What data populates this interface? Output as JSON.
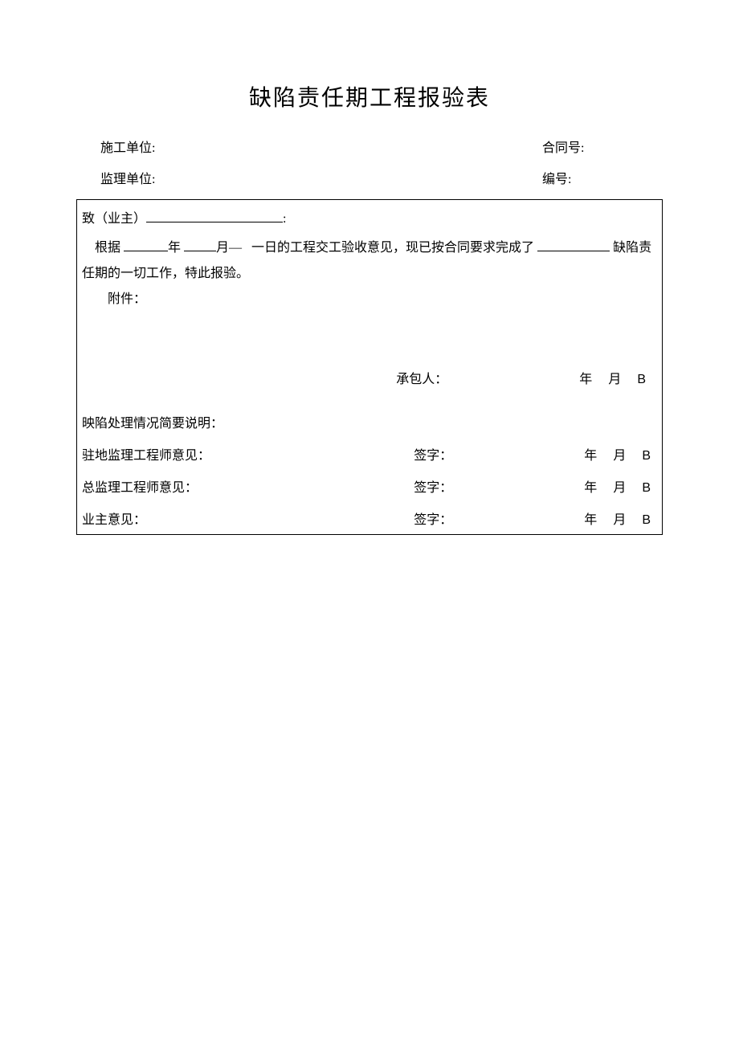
{
  "title": "缺陷责任期工程报验表",
  "header": {
    "construction_unit_label": "施工单位:",
    "contract_no_label": "合同号:",
    "supervision_unit_label": "监理单位:",
    "serial_no_label": "编号:"
  },
  "section1": {
    "to_owner": "致（业主）",
    "colon": ":",
    "basis_prefix": "根据",
    "year_char": "年",
    "month_char": "月",
    "day_text": "一日的工程交工验收意见，现已按合同要求完成了",
    "defect_resp_suffix": "缺陷责",
    "line2": "任期的一切工作，特此报验。",
    "attachment": "附件：",
    "contractor_label": "承包人：",
    "year": "年",
    "month": "月",
    "b": "B"
  },
  "section2": {
    "heading": "映陷处理情况简要说明："
  },
  "section3": {
    "heading": "驻地监理工程师意见：",
    "sign_label": "签字：",
    "year": "年",
    "month": "月",
    "b": "B"
  },
  "section4": {
    "heading": "总监理工程师意见：",
    "sign_label": "签字：",
    "year": "年",
    "month": "月",
    "b": "B"
  },
  "section5": {
    "heading": "业主意见：",
    "sign_label": "签字：",
    "year": "年",
    "month": "月",
    "b": "B"
  }
}
